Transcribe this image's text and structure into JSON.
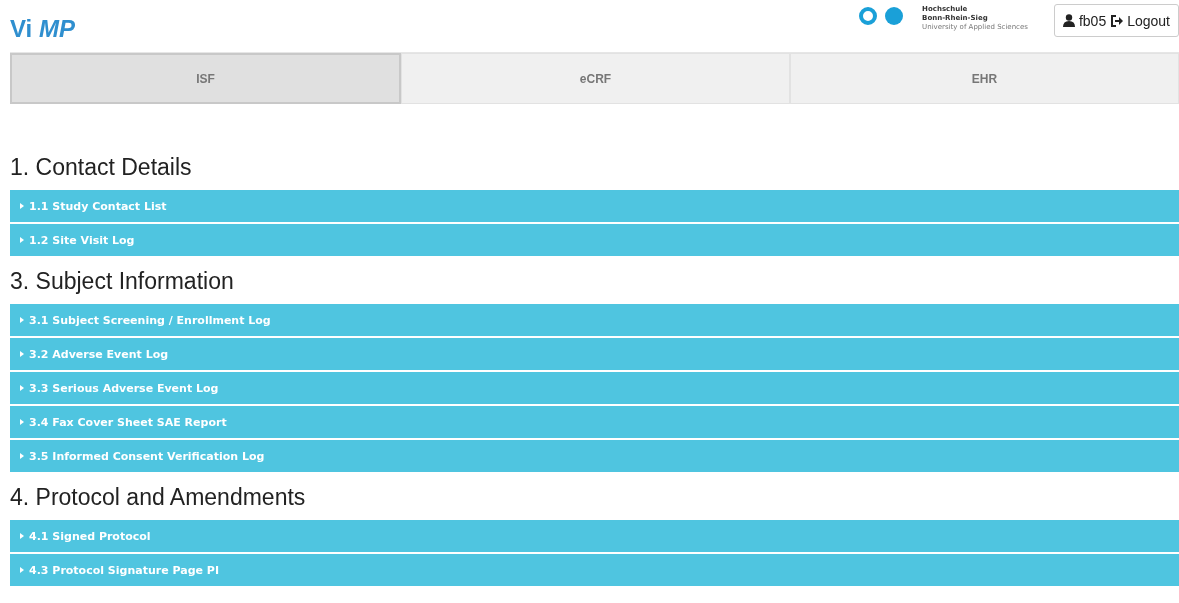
{
  "logo": "Vi *MP*",
  "university": {
    "lines": [
      "Hochschule",
      "Bonn-Rhein-Sieg",
      "University of Applied Sciences"
    ]
  },
  "user": {
    "name": "fb05",
    "logout": "Logout"
  },
  "tabs": [
    {
      "label": "ISF",
      "selected": true
    },
    {
      "label": "eCRF",
      "selected": false
    },
    {
      "label": "EHR",
      "selected": false
    }
  ],
  "sections": [
    {
      "title": "1. Contact Details",
      "items": [
        {
          "label": "1.1 Study Contact List",
          "expanded": false
        },
        {
          "label": "1.2 Site Visit Log",
          "expanded": false
        }
      ]
    },
    {
      "title": "3. Subject Information",
      "items": [
        {
          "label": "3.1 Subject Screening / Enrollment Log",
          "expanded": false
        },
        {
          "label": "3.2 Adverse Event Log",
          "expanded": false
        },
        {
          "label": "3.3 Serious Adverse Event Log",
          "expanded": false
        },
        {
          "label": "3.4 Fax Cover Sheet SAE Report",
          "expanded": false
        },
        {
          "label": "3.5 Informed Consent Verification Log",
          "expanded": false
        }
      ]
    },
    {
      "title": "4. Protocol and Amendments",
      "items": [
        {
          "label": "4.1 Signed Protocol",
          "expanded": false
        },
        {
          "label": "4.3 Protocol Signature Page PI",
          "expanded": false
        }
      ]
    }
  ]
}
